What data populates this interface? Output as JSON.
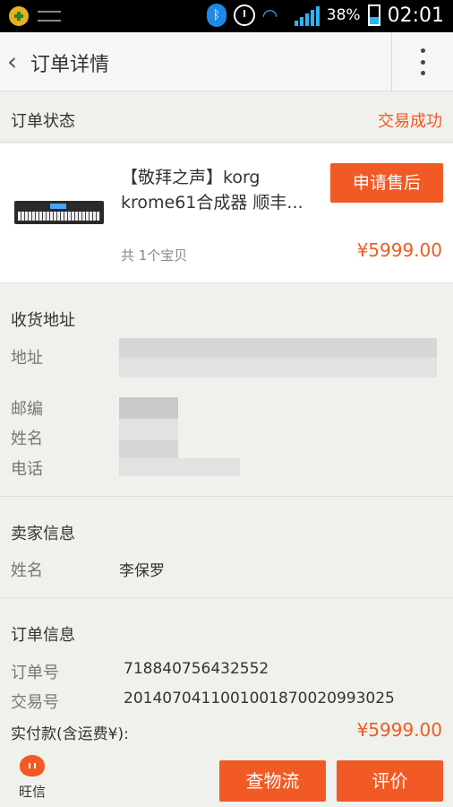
{
  "statusbar": {
    "battery_pct": "38%",
    "time": "02:01"
  },
  "appbar": {
    "title": "订单详情"
  },
  "order_status": {
    "label": "订单状态",
    "value": "交易成功"
  },
  "product": {
    "name_line1": "【敬拜之声】korg",
    "name_line2": "krome61合成器 顺丰...",
    "count": "共 1个宝贝",
    "price": "¥5999.00",
    "after_sale_button": "申请售后"
  },
  "address": {
    "heading": "收货地址",
    "address_label": "地址",
    "postcode_label": "邮编",
    "name_label": "姓名",
    "phone_label": "电话"
  },
  "seller": {
    "heading": "卖家信息",
    "name_label": "姓名",
    "name_value": "李保罗"
  },
  "order_info": {
    "heading": "订单信息",
    "order_no_label": "订单号",
    "order_no_value": "718840756432552",
    "trade_no_label": "交易号",
    "trade_no_value": "2014070411001001870020993025",
    "paid_label": "实付款(含运费¥):",
    "paid_value": "¥5999.00"
  },
  "bottombar": {
    "wangxin_label": "旺信",
    "logistics_button": "查物流",
    "review_button": "评价"
  },
  "colors": {
    "accent": "#f15a24",
    "background": "#eef1ec",
    "statusbar_icons": "#29b6f6"
  }
}
